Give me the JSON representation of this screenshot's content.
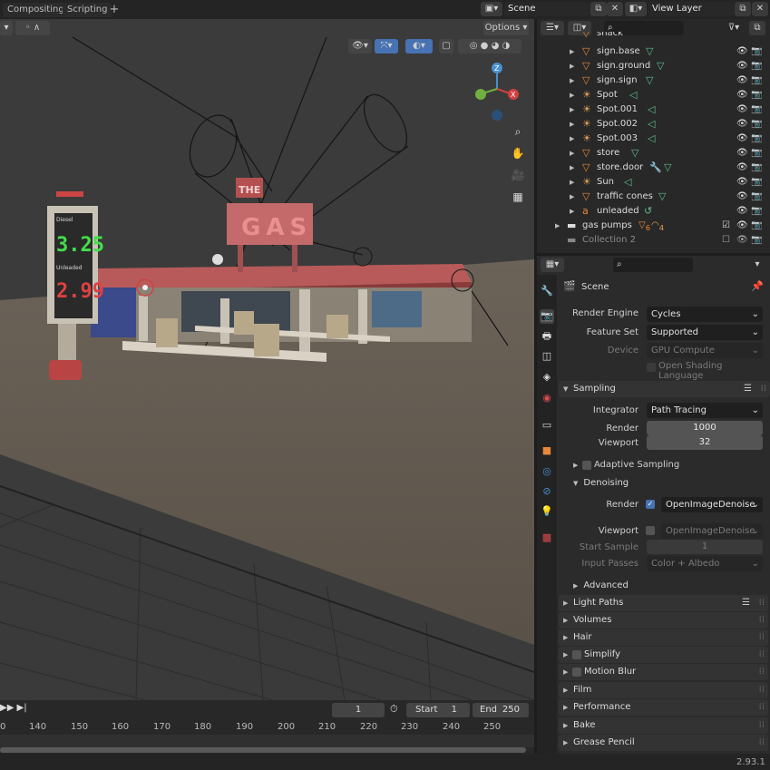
{
  "workspace_tabs": [
    "Compositing",
    "Scripting"
  ],
  "top": {
    "scene": "Scene",
    "view_layer": "View Layer"
  },
  "viewport": {
    "options_label": "Options",
    "sign_diesel": "Diesel",
    "sign_diesel_price": "3.25",
    "sign_unleaded": "Unleaded",
    "sign_unleaded_price": "2.99",
    "sign_the": "THE",
    "sign_gas": "GAS"
  },
  "timeline": {
    "current_frame": "1",
    "start_label": "Start",
    "start_value": "1",
    "end_label": "End",
    "end_value": "250",
    "ticks": [
      "0",
      "140",
      "150",
      "160",
      "170",
      "180",
      "190",
      "200",
      "210",
      "220",
      "230",
      "240",
      "250"
    ]
  },
  "outliner": {
    "items": [
      {
        "label": "snack",
        "type": "mesh"
      },
      {
        "label": "sign.base",
        "type": "mesh"
      },
      {
        "label": "sign.ground",
        "type": "mesh"
      },
      {
        "label": "sign.sign",
        "type": "mesh"
      },
      {
        "label": "Spot",
        "type": "light"
      },
      {
        "label": "Spot.001",
        "type": "light"
      },
      {
        "label": "Spot.002",
        "type": "light"
      },
      {
        "label": "Spot.003",
        "type": "light"
      },
      {
        "label": "store",
        "type": "mesh"
      },
      {
        "label": "store.door",
        "type": "mesh"
      },
      {
        "label": "Sun",
        "type": "light"
      },
      {
        "label": "traffic cones",
        "type": "mesh"
      },
      {
        "label": "unleaded",
        "type": "text"
      }
    ],
    "collections": [
      {
        "label": "gas pumps",
        "badge1": "6",
        "badge2": "4"
      },
      {
        "label": "Collection 2"
      }
    ]
  },
  "properties": {
    "context": "Scene",
    "render_engine_label": "Render Engine",
    "render_engine": "Cycles",
    "feature_set_label": "Feature Set",
    "feature_set": "Supported",
    "device_label": "Device",
    "device": "GPU Compute",
    "open_shading": "Open Shading Language",
    "sampling": "Sampling",
    "integrator_label": "Integrator",
    "integrator": "Path Tracing",
    "render_label": "Render",
    "render_samples": "1000",
    "viewport_label": "Viewport",
    "viewport_samples": "32",
    "adaptive_sampling": "Adaptive Sampling",
    "denoising": "Denoising",
    "denoise_render_label": "Render",
    "denoise_render": "OpenImageDenoise",
    "denoise_viewport_label": "Viewport",
    "denoise_viewport": "OpenImageDenoise",
    "start_sample_label": "Start Sample",
    "start_sample": "1",
    "input_passes_label": "Input Passes",
    "input_passes": "Color + Albedo",
    "advanced": "Advanced",
    "panels": [
      "Light Paths",
      "Volumes",
      "Hair",
      "Simplify",
      "Motion Blur",
      "Film",
      "Performance",
      "Bake",
      "Grease Pencil"
    ]
  },
  "version": "2.93.1",
  "colors": {
    "accent": "#4772b3",
    "mesh_icon": "#e8883a",
    "light_icon": "#e8a05a",
    "data_icon": "#5fbf8f"
  }
}
